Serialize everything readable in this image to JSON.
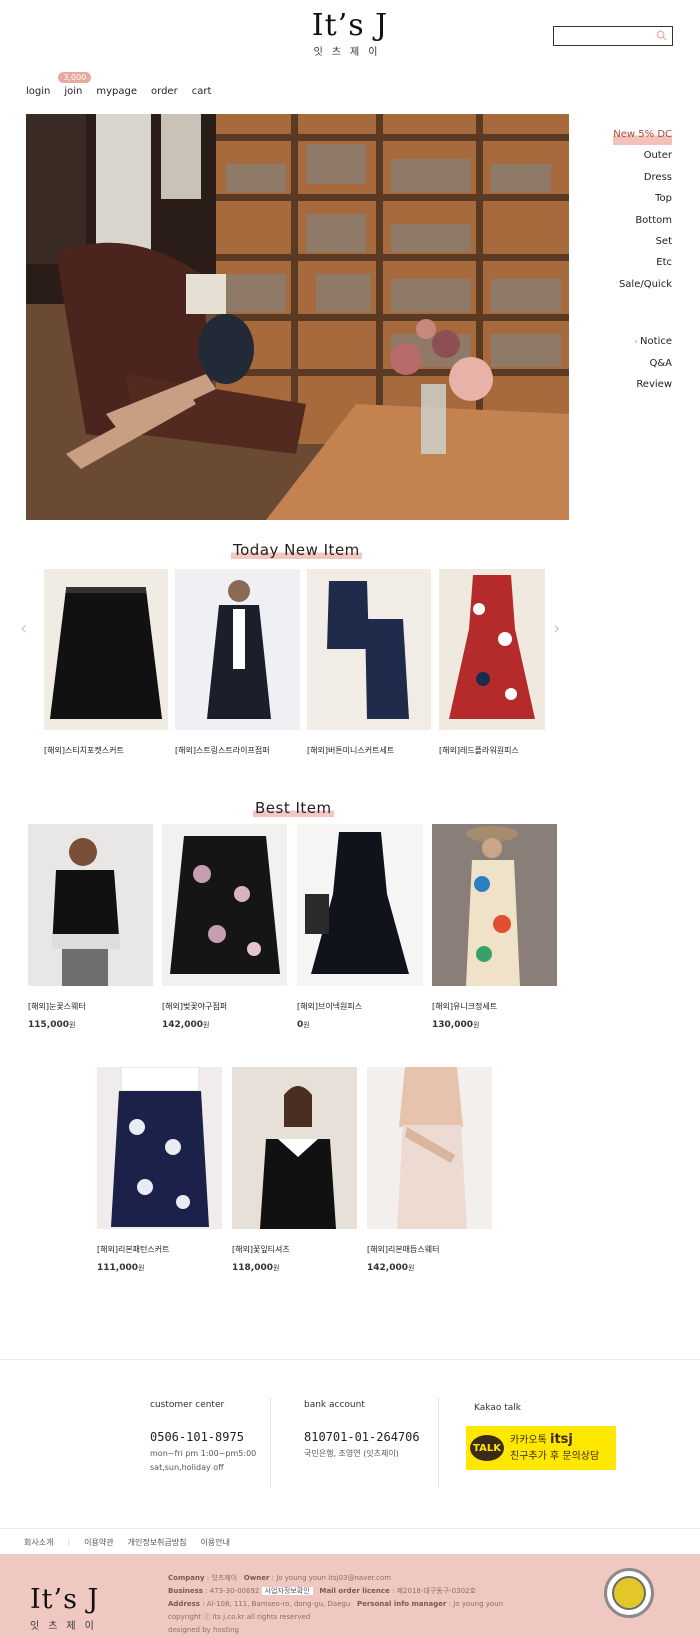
{
  "brand": {
    "logo_en": "It’s J",
    "logo_kr": "잇츠제이"
  },
  "search": {
    "placeholder": ""
  },
  "topnav": {
    "login": "login",
    "join": "join",
    "join_badge": "3,000",
    "mypage": "mypage",
    "order": "order",
    "cart": "cart"
  },
  "sidenav": {
    "categories": [
      "New 5% DC",
      "Outer",
      "Dress",
      "Top",
      "Bottom",
      "Set",
      "Etc",
      "Sale/Quick"
    ],
    "board": [
      "Notice",
      "Q&A",
      "Review"
    ]
  },
  "today_new": {
    "title": "Today New Item",
    "prev_arrow": "‹",
    "next_arrow": "›",
    "items": [
      {
        "name": "[해외]스티치포켓스커트"
      },
      {
        "name": "[해외]스트링스트라이프점퍼"
      },
      {
        "name": "[해외]버튼미니스커트세트"
      },
      {
        "name": "[해외]레드플라워원피스"
      }
    ]
  },
  "best": {
    "title": "Best Item",
    "currency": "원",
    "items": [
      {
        "name": "[해외]눈꽃스웨터",
        "price": "115,000"
      },
      {
        "name": "[해외]벚꽃야구점퍼",
        "price": "142,000"
      },
      {
        "name": "[해외]브이넥원피스",
        "price": "0"
      },
      {
        "name": "[해외]유니크정세트",
        "price": "130,000"
      },
      {
        "name": "[해외]리본패턴스커트",
        "price": "111,000"
      },
      {
        "name": "[해외]꽃잎티셔츠",
        "price": "118,000"
      },
      {
        "name": "[해외]리본매듭스웨터",
        "price": "142,000"
      }
    ]
  },
  "footer": {
    "customer_center": {
      "title": "customer center",
      "phone": "0506-101-8975",
      "hours": "mon~fri pm 1:00~pm5:00",
      "closed": "sat,sun,holiday off"
    },
    "bank": {
      "title": "bank account",
      "number": "810701-01-264706",
      "holder": "국민은행, 조영연 (잇츠제이)"
    },
    "kakao": {
      "title": "Kakao talk",
      "badge": "TALK",
      "line1_prefix": "카카오톡",
      "line1_id": "itsj",
      "line2": "친구추가 후 문의상담"
    },
    "links": [
      "회사소개",
      "이용약관",
      "개인정보취급방침",
      "이용안내"
    ],
    "info": {
      "company_label": "Company",
      "company": "잇츠제이",
      "owner_label": "Owner",
      "owner": "Jo young youn",
      "email": "itsj03@naver.com",
      "business_label": "Business",
      "business": "473-30-00692",
      "business_chip": "사업자정보확인",
      "mail_label": "Mail order licence",
      "mail": "제2018-대구동구-0302호",
      "address_label": "Address",
      "address": "Al-108, 111, Bamseo-ro, dong-gu, Daegu",
      "manager_label": "Personal info manager",
      "manager": "Jo young youn",
      "copyright": "copyright ⓒ its j.co.kr all rights reserved",
      "designed": "designed by hosting"
    }
  },
  "colors": {
    "accent_pink": "#efc8c2",
    "highlight": "#f3c1bb",
    "kakao_yellow": "#ffe800"
  }
}
